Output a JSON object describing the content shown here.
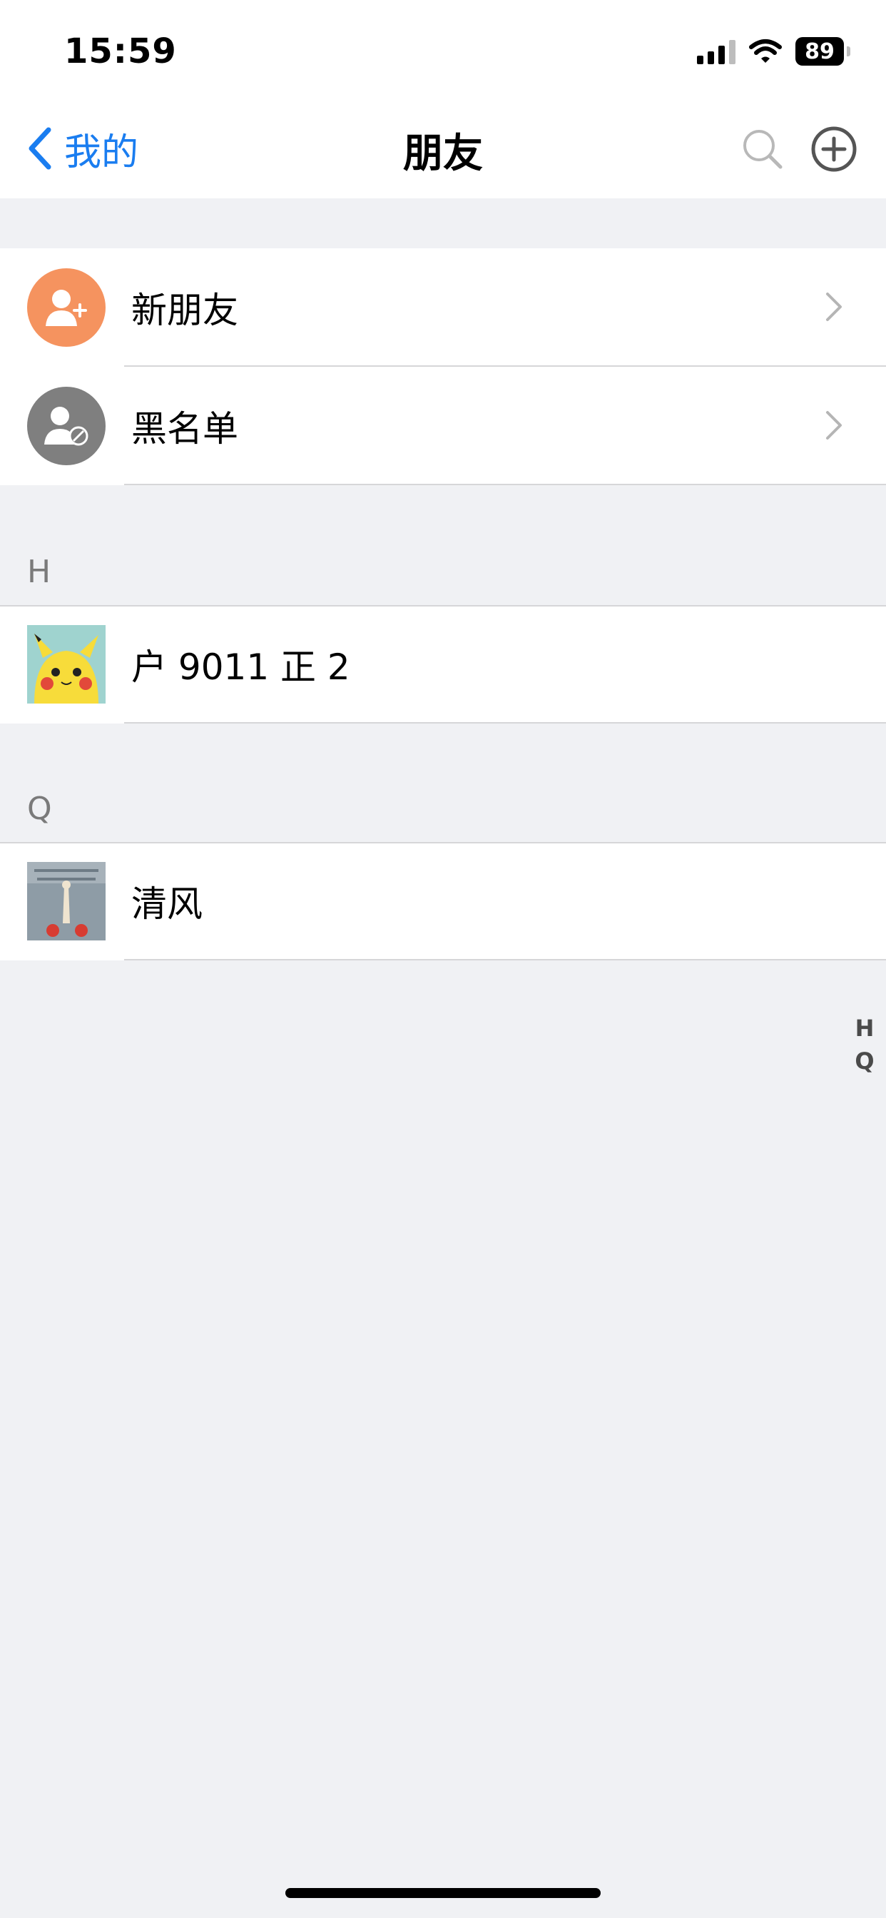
{
  "status_bar": {
    "time": "15:59",
    "battery": "89"
  },
  "nav": {
    "back_label": "我的",
    "title": "朋友"
  },
  "menu": [
    {
      "label": "新朋友",
      "icon": "add-friend-icon",
      "color": "#f5935f"
    },
    {
      "label": "黑名单",
      "icon": "blocked-user-icon",
      "color": "#7f7f7f"
    }
  ],
  "sections": [
    {
      "header": "H",
      "contacts": [
        {
          "name": "户 9011 正 2",
          "avatar": "pikachu-avatar"
        }
      ]
    },
    {
      "header": "Q",
      "contacts": [
        {
          "name": "清风",
          "avatar": "picture-avatar"
        }
      ]
    }
  ],
  "index": [
    "H",
    "Q"
  ],
  "colors": {
    "accent": "#1a7df0",
    "background": "#f0f1f4"
  }
}
